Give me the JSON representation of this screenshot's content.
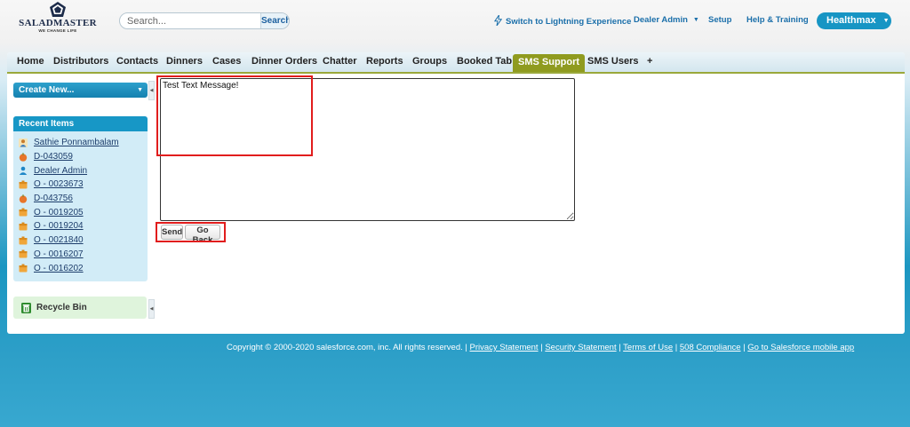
{
  "header": {
    "logo_name": "SALADMASTER",
    "logo_tagline": "WE CHANGE LIFE",
    "search": {
      "placeholder": "Search...",
      "button_label": "Search"
    },
    "links": {
      "lightning": "Switch to Lightning Experience",
      "dealer_admin": "Dealer Admin",
      "setup": "Setup",
      "help": "Help & Training"
    },
    "user_menu": "Healthmax"
  },
  "tabs": [
    {
      "label": "Home"
    },
    {
      "label": "Distributors"
    },
    {
      "label": "Contacts"
    },
    {
      "label": "Dinners"
    },
    {
      "label": "Cases"
    },
    {
      "label": "Dinner Orders"
    },
    {
      "label": "Chatter"
    },
    {
      "label": "Reports"
    },
    {
      "label": "Groups"
    },
    {
      "label": "Booked Tab"
    },
    {
      "label": "SMS Support",
      "active": true
    },
    {
      "label": "SMS Users"
    },
    {
      "label": "+"
    }
  ],
  "sidebar": {
    "create_new": "Create New...",
    "recent_title": "Recent Items",
    "recent_items": [
      {
        "label": "Sathie Ponnambalam",
        "icon": "contact-icon"
      },
      {
        "label": "D-043059",
        "icon": "dinner-icon"
      },
      {
        "label": "Dealer Admin",
        "icon": "user-icon"
      },
      {
        "label": "O - 0023673",
        "icon": "order-icon"
      },
      {
        "label": "D-043756",
        "icon": "dinner-icon"
      },
      {
        "label": "O - 0019205",
        "icon": "order-icon"
      },
      {
        "label": "O - 0019204",
        "icon": "order-icon"
      },
      {
        "label": "O - 0021840",
        "icon": "order-icon"
      },
      {
        "label": "O - 0016207",
        "icon": "order-icon"
      },
      {
        "label": "O - 0016202",
        "icon": "order-icon"
      }
    ],
    "recycle_bin": "Recycle Bin"
  },
  "form": {
    "message_value": "Test Text Message!",
    "send_label": "Send",
    "go_back_label": "Go Back"
  },
  "footer": {
    "copyright": "Copyright © 2000-2020 salesforce.com, inc. All rights reserved. |",
    "links": [
      "Privacy Statement",
      "Security Statement",
      "Terms of Use",
      "508 Compliance",
      "Go to Salesforce mobile app"
    ]
  },
  "colors": {
    "brand_blue": "#1797c6",
    "active_tab": "#8f9b1f",
    "highlight_red": "#e11d1d"
  }
}
